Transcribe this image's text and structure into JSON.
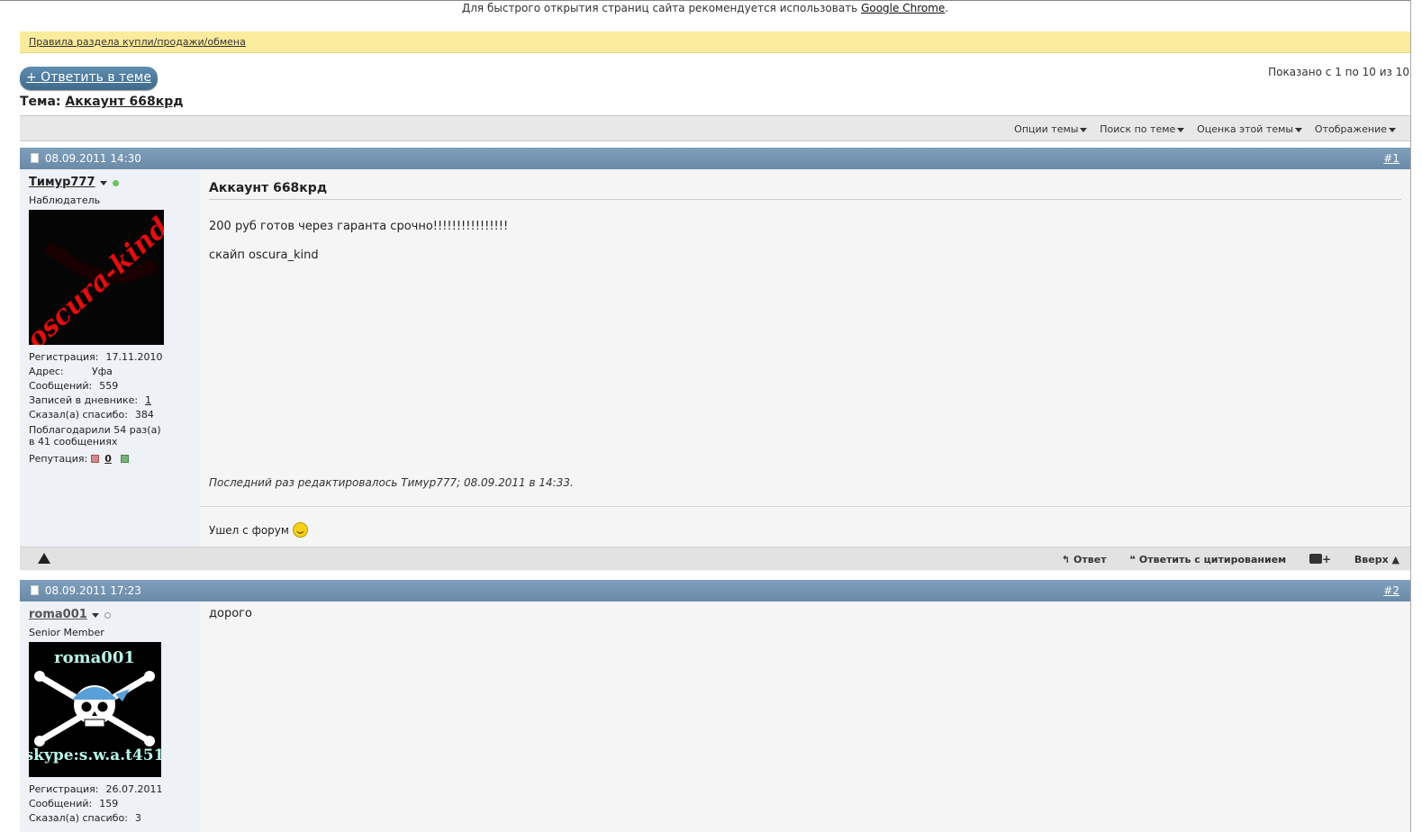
{
  "notice": {
    "prefix": "Для быстрого открытия страниц сайта рекомендуется использовать ",
    "link": "Google Chrome",
    "suffix": "."
  },
  "rules_link": "Правила раздела купли/продажи/обмена",
  "reply_button": "+ Ответить в теме",
  "pagination_info": "Показано с 1 по 10 из 10",
  "thread": {
    "label": "Тема:",
    "title": "Аккаунт 668крд"
  },
  "toolbar": {
    "thread_options": "Опции темы",
    "search_thread": "Поиск по теме",
    "rate_thread": "Оценка этой темы",
    "display": "Отображение"
  },
  "posts": [
    {
      "date": "08.09.2011 14:30",
      "number": "#1",
      "username": "Тимур777",
      "usertitle": "Наблюдатель",
      "stats": [
        {
          "k": "Регистрация:",
          "v": "17.11.2010"
        },
        {
          "k": "Адрес:",
          "v": "Уфа"
        },
        {
          "k": "Сообщений:",
          "v": "559"
        },
        {
          "k": "Записей в дневнике:",
          "v": "1"
        },
        {
          "k": "Сказал(а) спасибо:",
          "v": "384"
        }
      ],
      "thanked_line1": "Поблагодарили 54 раз(а)",
      "thanked_line2": "в 41 сообщениях",
      "reputation_label": "Репутация:",
      "reputation_value": "0",
      "title": "Аккаунт 668крд",
      "message_line1": "200 руб готов через гаранта срочно!!!!!!!!!!!!!!!!",
      "message_line2": "скайп oscura_kind",
      "edited": "Последний раз редактировалось Тимур777; 08.09.2011 в 14:33.",
      "signature": "Ушел с форум",
      "avatar_text": "oscura-kind",
      "actions": {
        "reply": "Ответ",
        "quote": "Ответить с цитированием",
        "top": "Вверх"
      }
    },
    {
      "date": "08.09.2011 17:23",
      "number": "#2",
      "username": "roma001",
      "usertitle": "Senior Member",
      "stats": [
        {
          "k": "Регистрация:",
          "v": "26.07.2011"
        },
        {
          "k": "Сообщений:",
          "v": "159"
        },
        {
          "k": "Сказал(а) спасибо:",
          "v": "3"
        }
      ],
      "message": "дорого",
      "avatar_top": "roma001",
      "avatar_bottom": "skype:s.w.a.t451"
    }
  ],
  "colors": {
    "header_blue": "#7395b4",
    "rules_yellow": "#fbeb9c",
    "button_blue": "#4f7b9e"
  }
}
